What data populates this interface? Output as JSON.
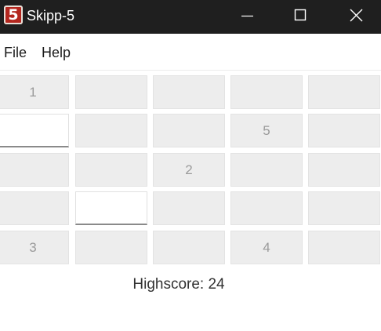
{
  "window": {
    "app_icon_glyph": "5",
    "title": "Skipp-5",
    "minimize_icon": "minimize-icon",
    "maximize_icon": "maximize-icon",
    "close_icon": "close-icon"
  },
  "menu": {
    "items": [
      {
        "label": "File"
      },
      {
        "label": "Help"
      }
    ]
  },
  "board": {
    "rows": [
      [
        {
          "value": "1",
          "state": "normal"
        },
        {
          "value": "",
          "state": "normal"
        },
        {
          "value": "",
          "state": "normal"
        },
        {
          "value": "",
          "state": "normal"
        },
        {
          "value": "",
          "state": "normal"
        }
      ],
      [
        {
          "value": "",
          "state": "active"
        },
        {
          "value": "",
          "state": "normal"
        },
        {
          "value": "",
          "state": "normal"
        },
        {
          "value": "5",
          "state": "normal"
        },
        {
          "value": "",
          "state": "normal"
        }
      ],
      [
        {
          "value": "",
          "state": "normal"
        },
        {
          "value": "",
          "state": "normal"
        },
        {
          "value": "2",
          "state": "normal"
        },
        {
          "value": "",
          "state": "normal"
        },
        {
          "value": "",
          "state": "normal"
        }
      ],
      [
        {
          "value": "",
          "state": "normal"
        },
        {
          "value": "",
          "state": "active"
        },
        {
          "value": "",
          "state": "normal"
        },
        {
          "value": "",
          "state": "normal"
        },
        {
          "value": "",
          "state": "normal"
        }
      ],
      [
        {
          "value": "3",
          "state": "normal"
        },
        {
          "value": "",
          "state": "normal"
        },
        {
          "value": "",
          "state": "normal"
        },
        {
          "value": "4",
          "state": "normal"
        },
        {
          "value": "",
          "state": "normal"
        }
      ]
    ]
  },
  "highscore": {
    "text": "Highscore: 24"
  },
  "colors": {
    "titlebar_bg": "#1f1f1f",
    "icon_red": "#b3261e",
    "cell_bg": "#ededed",
    "cell_active_bg": "#ffffff"
  }
}
